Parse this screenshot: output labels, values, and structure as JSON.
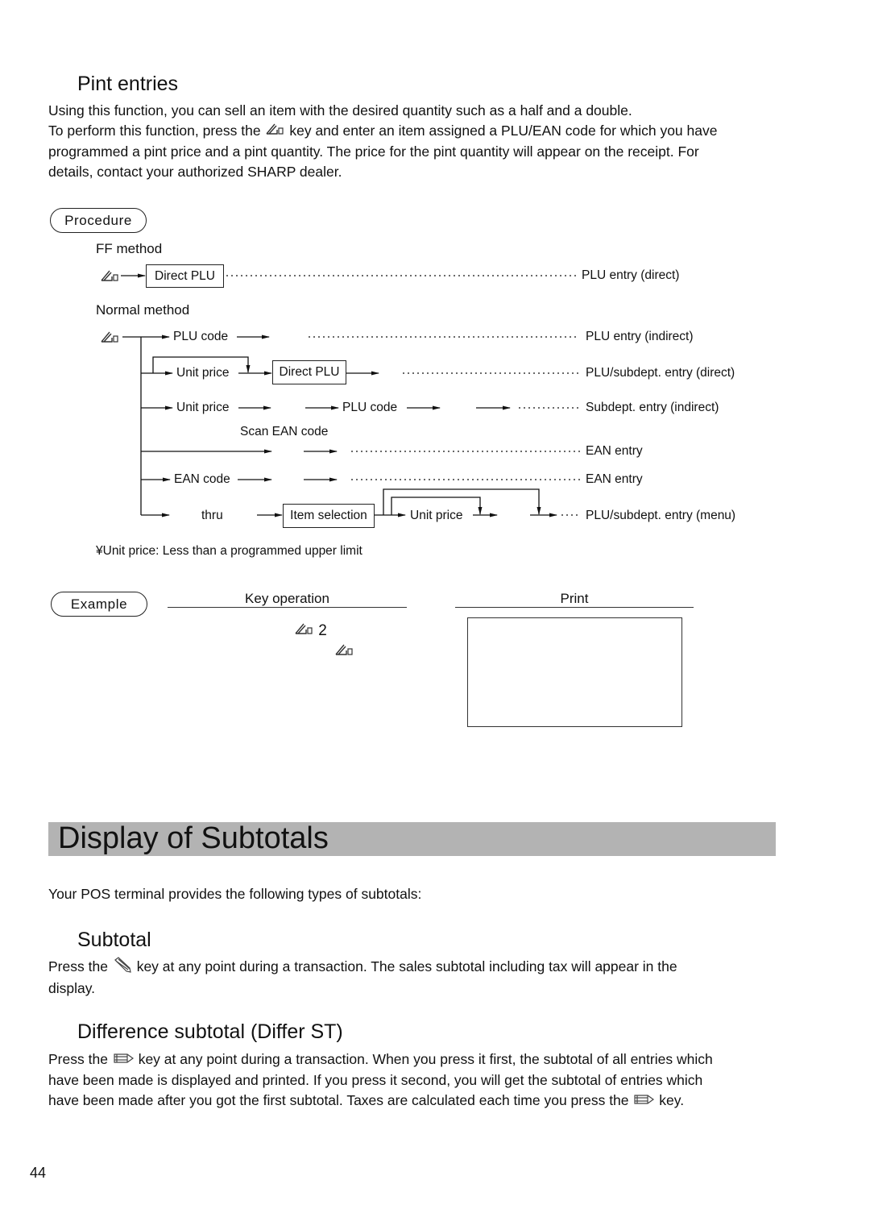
{
  "pint_entries": {
    "heading": "Pint entries",
    "para_line1": "Using this function, you can sell an item with the desired quantity such as a half and a double.",
    "para_line2_before_key": "To perform this function, press the",
    "para_line2_after_key": "key and enter an item assigned a PLU/EAN code for which you have",
    "para_line3": "programmed a pint price and a pint quantity. The price for the pint quantity will appear on the receipt. For",
    "para_line4": "details, contact your authorized SHARP dealer.",
    "key_icon": "pint-key-icon"
  },
  "procedure": {
    "label": "Procedure",
    "ff_method": {
      "title": "FF method",
      "box": "Direct PLU",
      "result": "PLU entry (direct)"
    },
    "normal_method": {
      "title": "Normal method",
      "rows": [
        {
          "steps": [
            "PLU code"
          ],
          "result": "PLU entry (indirect)"
        },
        {
          "steps": [
            "Unit price",
            "Direct PLU"
          ],
          "result": "PLU/subdept. entry (direct)"
        },
        {
          "steps": [
            "Unit price",
            "PLU code"
          ],
          "result": "Subdept. entry (indirect)"
        },
        {
          "steps": [
            "Scan EAN code"
          ],
          "result": "EAN entry"
        },
        {
          "steps": [
            "EAN code"
          ],
          "result": "EAN entry"
        },
        {
          "steps": [
            "thru",
            "Item selection",
            "Unit price"
          ],
          "result": "PLU/subdept. entry (menu)"
        }
      ]
    },
    "footnote": "¥Unit price: Less than a programmed upper limit"
  },
  "example": {
    "label": "Example",
    "key_operation_header": "Key operation",
    "print_header": "Print",
    "key_line1_value": "2"
  },
  "display_subtotals": {
    "banner": "Display of Subtotals",
    "intro": "Your POS terminal provides the following types of subtotals:",
    "subtotal": {
      "heading": "Subtotal",
      "line1_before_key": "Press the",
      "line1_after_key": "key at any point during a transaction.  The sales subtotal including tax will appear in the",
      "line2": "display.",
      "key_icon": "subtotal-key-icon"
    },
    "differ_st": {
      "heading": "Difference subtotal (Differ ST)",
      "line1_before_key": "Press the",
      "line1_after_key": "key at any point during a transaction. When you press it first, the subtotal of all entries which",
      "line2": "have been made is displayed and printed. If you press it second, you will get the subtotal of entries which",
      "line3_before_key": "have been made after you got the first subtotal. Taxes are calculated each time you press the",
      "line3_after_key": "key.",
      "key_icon": "differ-st-key-icon"
    }
  },
  "page_number": "44"
}
